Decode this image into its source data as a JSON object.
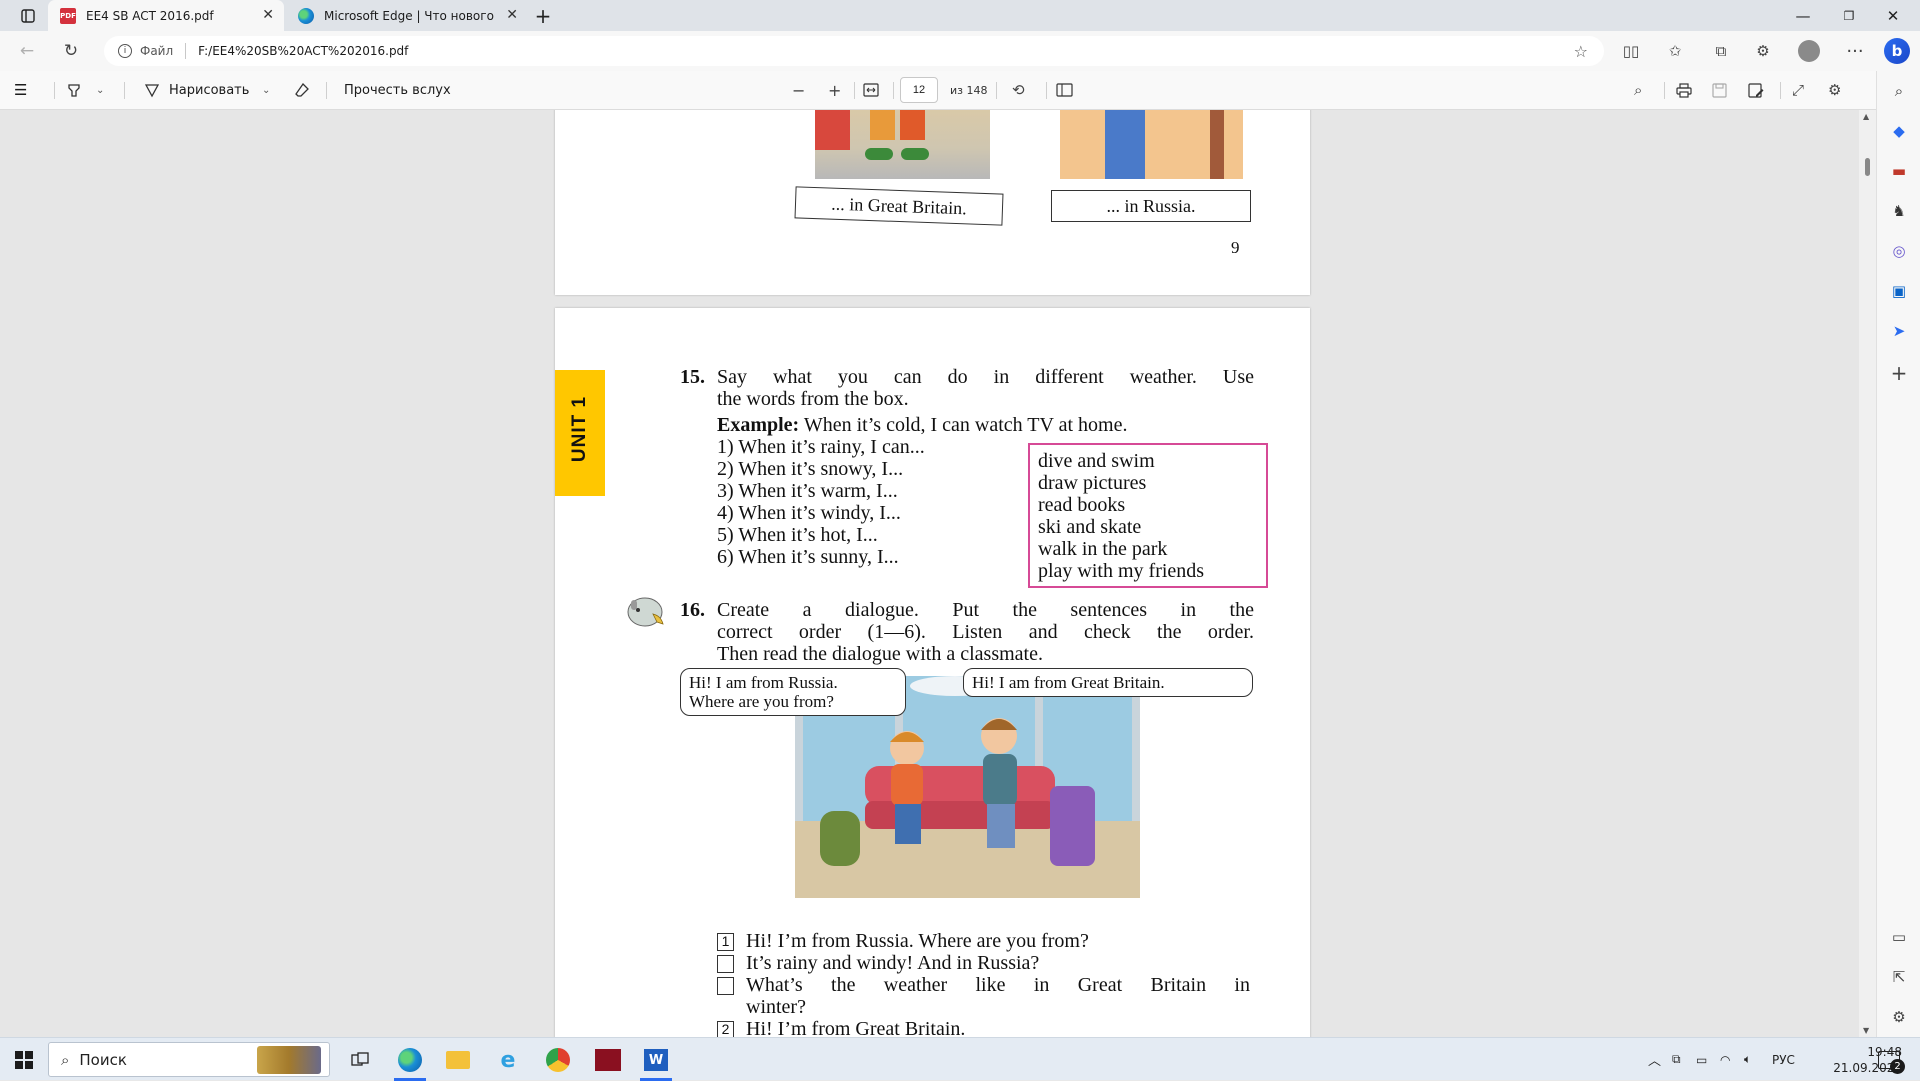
{
  "tabs": [
    {
      "title": "EE4 SB ACT 2016.pdf",
      "icon": "pdf-icon",
      "active": true
    },
    {
      "title": "Microsoft Edge | Что нового",
      "icon": "edge-icon",
      "active": false
    }
  ],
  "address": {
    "scheme_label": "Файл",
    "url": "F:/EE4%20SB%20ACT%202016.pdf"
  },
  "pdf_toolbar": {
    "draw_label": "Нарисовать",
    "read_aloud_label": "Прочесть вслух",
    "page_current": "12",
    "page_total": "из 148"
  },
  "pdf_badge": "PDF",
  "page_top": {
    "caption_left": "... in Great Britain.",
    "caption_right": "... in Russia.",
    "page_number": "9"
  },
  "page_main": {
    "unit_tab": "UNIT 1",
    "ex15": {
      "number": "15.",
      "instruction_line1": "Say what you can do in different weather. Use",
      "instruction_line2": "the words from the box.",
      "example_label": "Example:",
      "example_text": "When it’s cold, I can watch TV at home.",
      "items": [
        "1) When it’s rainy, I can...",
        "2) When it’s snowy, I...",
        "3) When it’s warm, I...",
        "4) When it’s windy, I...",
        "5) When it’s hot, I...",
        "6) When it’s sunny, I..."
      ],
      "box_words": [
        "dive and swim",
        "draw pictures",
        "read books",
        "ski and skate",
        "walk in the park",
        "play with my friends"
      ]
    },
    "ex16": {
      "number": "16.",
      "line1": "Create a dialogue. Put the sentences in the",
      "line2": "correct order (1—6). Listen and check the order.",
      "line3": "Then read the dialogue with a classmate.",
      "bubble_left_line1": "Hi! I am from Russia.",
      "bubble_left_line2": "Where are you from?",
      "bubble_right": "Hi! I am from Great Britain.",
      "lines": [
        {
          "mark": "1",
          "text": "Hi! I’m from Russia. Where are you from?"
        },
        {
          "mark": "",
          "text": "It’s rainy and windy! And in Russia?"
        },
        {
          "mark": "",
          "text": "What’s the weather like in Great Britain in"
        },
        {
          "mark": "",
          "text": "winter?"
        },
        {
          "mark": "2",
          "text": "Hi! I’m from Great Britain."
        }
      ]
    }
  },
  "taskbar": {
    "search_placeholder": "Поиск",
    "lang": "РУС",
    "time": "19:48",
    "date": "21.09.2023",
    "notification_count": "2"
  },
  "colors": {
    "accent": "#2b6cf0",
    "unit_tab": "#ffc700",
    "word_box_border": "#d64a96"
  }
}
